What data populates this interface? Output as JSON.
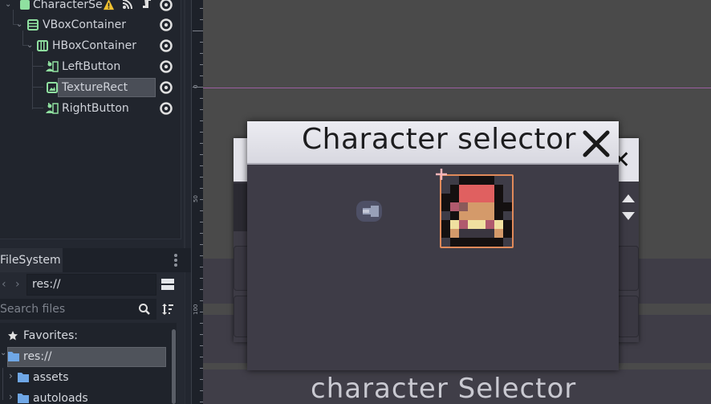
{
  "scene_tree": {
    "nodes": [
      {
        "label": "CharacterSe",
        "type": "control",
        "has_warning": true,
        "has_signal": true,
        "has_script": true
      },
      {
        "label": "VBoxContainer",
        "type": "vbox"
      },
      {
        "label": "HBoxContainer",
        "type": "hbox"
      },
      {
        "label": "LeftButton",
        "type": "texture-button"
      },
      {
        "label": "TextureRect",
        "type": "texture-rect",
        "selected": true
      },
      {
        "label": "RightButton",
        "type": "texture-button"
      }
    ]
  },
  "filesystem": {
    "tab_label": "FileSystem",
    "path_value": "res://",
    "search_placeholder": "Search files",
    "favorites_label": "Favorites:",
    "items": [
      {
        "label": "res://",
        "selected": true
      },
      {
        "label": "assets"
      },
      {
        "label": "autoloads"
      }
    ]
  },
  "ruler": {
    "labels": [
      "0",
      "50",
      "100"
    ]
  },
  "viewport": {
    "dialog_title": "Character selector",
    "background_title": "character Selector",
    "icons": {
      "close": "close-icon",
      "left_arrow": "left-arrow-icon",
      "right_arrow": "right-arrow-icon"
    },
    "colors": {
      "selection_outline": "#e08a5a",
      "guide_line": "#9b5fa0",
      "accent_icon": "#8fe0a0"
    }
  }
}
